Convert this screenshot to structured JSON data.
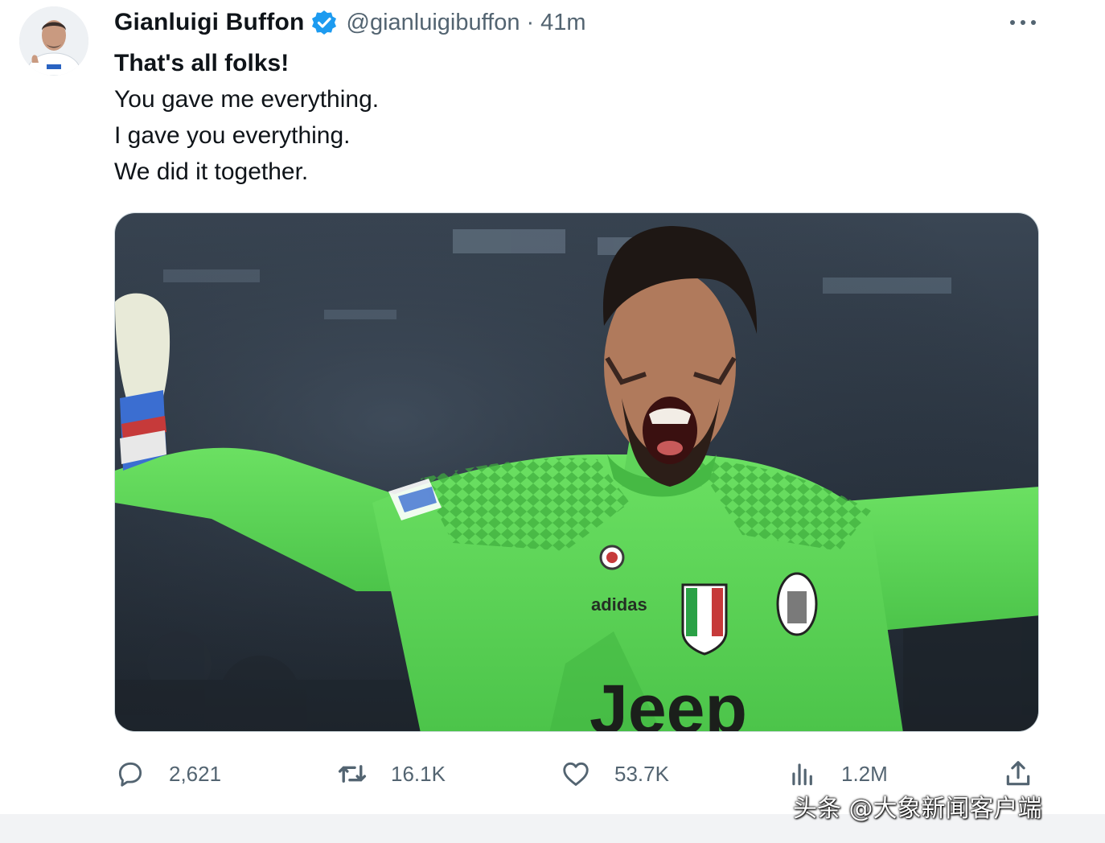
{
  "tweet": {
    "author": {
      "name": "Gianluigi Buffon",
      "handle": "@gianluigibuffon",
      "verified": true,
      "separator": "·",
      "time": "41m"
    },
    "text_lines": [
      "That's all folks!",
      "You gave me everything.",
      "I gave you everything.",
      "We did it together."
    ],
    "media": {
      "kind": "photo",
      "subject": "goalkeeper celebrating in green kit",
      "shirt_text": "Jeep",
      "brand_text": "adidas"
    },
    "actions": {
      "reply": {
        "icon": "reply-icon",
        "count": "2,621"
      },
      "retweet": {
        "icon": "retweet-icon",
        "count": "16.1K"
      },
      "like": {
        "icon": "heart-icon",
        "count": "53.7K"
      },
      "views": {
        "icon": "views-icon",
        "count": "1.2M"
      },
      "share": {
        "icon": "share-icon"
      }
    }
  },
  "watermark": "头条 @大象新闻客户端",
  "colors": {
    "text": "#0f1419",
    "secondary": "#536471",
    "verified": "#1d9bf0",
    "kit_green": "#5fd35a"
  }
}
